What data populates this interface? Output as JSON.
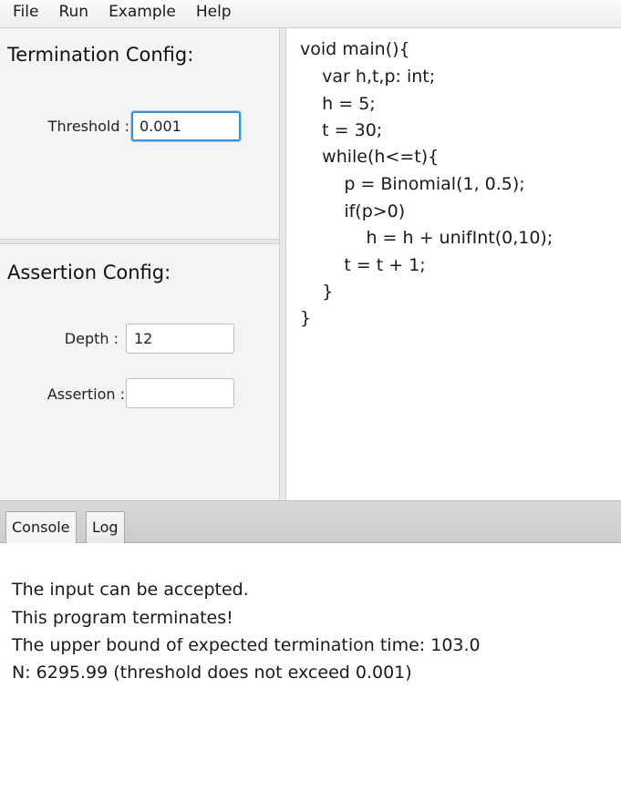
{
  "menu": {
    "items": [
      "File",
      "Run",
      "Example",
      "Help"
    ]
  },
  "termination": {
    "title": "Termination Config:",
    "threshold_label": "Threshold :",
    "threshold_value": "0.001"
  },
  "assertion": {
    "title": "Assertion Config:",
    "depth_label": "Depth :",
    "depth_value": "12",
    "assertion_label": "Assertion :",
    "assertion_value": ""
  },
  "code": {
    "lines": [
      "void main(){",
      "    var h,t,p: int;",
      "    h = 5;",
      "    t = 30;",
      "    while(h<=t){",
      "        p = Binomial(1, 0.5);",
      "        if(p>0)",
      "            h = h + unifInt(0,10);",
      "        t = t + 1;",
      "    }",
      "}"
    ]
  },
  "tabs": [
    {
      "label": "Console",
      "active": true
    },
    {
      "label": "Log",
      "active": false
    }
  ],
  "console": {
    "lines": [
      "The input can be accepted.",
      "This program terminates!",
      "The upper bound of expected termination time: 103.0",
      "N: 6295.99 (threshold does not exceed 0.001)"
    ]
  },
  "colors": {
    "focus_border": "#3d8fd6",
    "panel_bg": "#f4f4f4",
    "tabbar_bg": "#d2d2d2"
  }
}
